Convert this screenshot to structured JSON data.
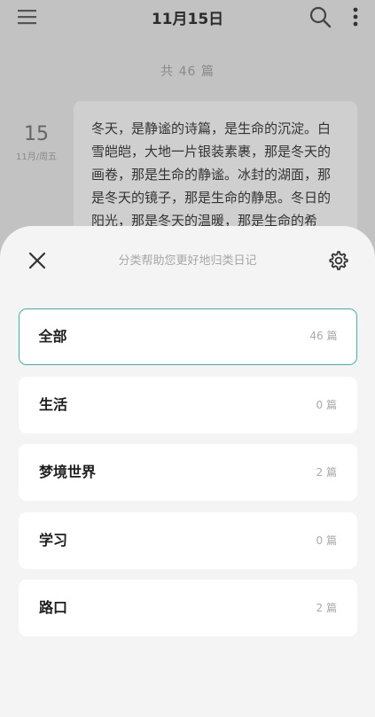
{
  "header": {
    "title": "11月15日",
    "menu_icon": "hamburger-menu-icon",
    "search_icon": "search-icon",
    "more_icon": "more-vertical-icon"
  },
  "summary": {
    "count_text": "共 46 篇"
  },
  "entry": {
    "day": "15",
    "sub_date": "11月/周五",
    "text": "冬天，是静谧的诗篇，是生命的沉淀。白雪皑皑，大地一片银装素裹，那是冬天的画卷，那是生命的静谧。冰封的湖面，那是冬天的镜子，那是生命的静思。冬日的阳光，那是冬天的温暖，那是生命的希"
  },
  "sheet": {
    "hint": "分类帮助您更好地归类日记",
    "close_icon": "close-icon",
    "settings_icon": "gear-icon",
    "categories": [
      {
        "label": "全部",
        "count": "46 篇",
        "active": true
      },
      {
        "label": "生活",
        "count": "0 篇",
        "active": false
      },
      {
        "label": "梦境世界",
        "count": "2 篇",
        "active": false
      },
      {
        "label": "学习",
        "count": "0 篇",
        "active": false
      },
      {
        "label": "路口",
        "count": "2 篇",
        "active": false
      }
    ]
  },
  "colors": {
    "accent": "#3ab4b4",
    "dim_background": "#c2c2c2",
    "sheet_background": "#f4f4f4"
  }
}
